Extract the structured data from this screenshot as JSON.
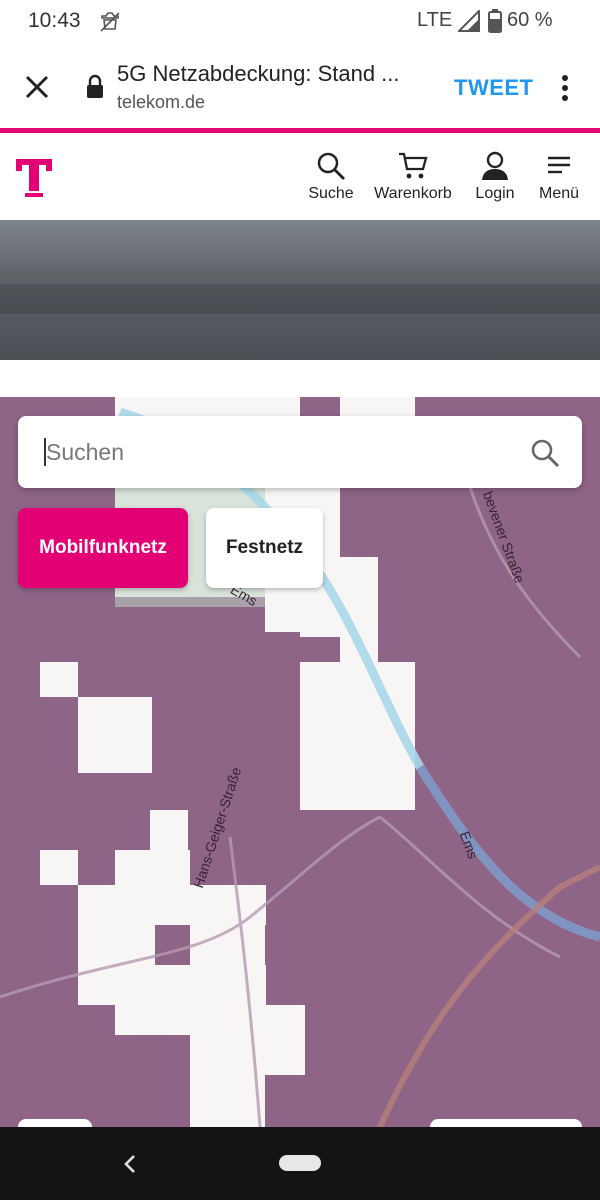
{
  "status_bar": {
    "time": "10:43",
    "network": "LTE",
    "battery": "60 %"
  },
  "tab_bar": {
    "title": "5G Netzabdeckung: Stand ...",
    "url": "telekom.de",
    "action": "TWEET"
  },
  "header": {
    "nav": [
      {
        "label": "Suche",
        "icon": "search-icon"
      },
      {
        "label": "Warenkorb",
        "icon": "cart-icon"
      },
      {
        "label": "Login",
        "icon": "user-icon"
      },
      {
        "label": "Menü",
        "icon": "menu-icon"
      }
    ],
    "brand_color": "#e20074"
  },
  "map": {
    "search_placeholder": "Suchen",
    "toggles": {
      "active": "Mobilfunknetz",
      "inactive": "Festnetz"
    },
    "labels": {
      "road1": "Hans-Geiger-Straße",
      "road2": "bevener Straße",
      "river1": "Ems",
      "river2": "Ems"
    },
    "coverage_color": "#8e6487"
  }
}
